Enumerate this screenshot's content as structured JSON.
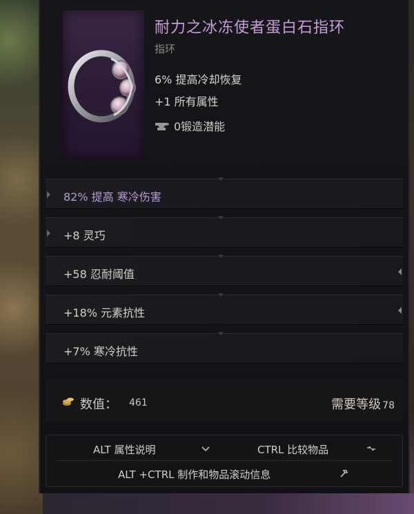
{
  "item": {
    "name": "耐力之冰冻使者蛋白石指环",
    "type": "指环",
    "implicits": [
      "6% 提高冷却恢复",
      "+1 所有属性"
    ],
    "forge_potential": "0锻造潜能"
  },
  "affixes": [
    {
      "text": "82% 提高 寒冷伤害",
      "tone": "purple",
      "arrow": "left"
    },
    {
      "text": "+8 灵巧",
      "tone": "normal",
      "arrow": "left"
    },
    {
      "text": "+58 忍耐阈值",
      "tone": "normal",
      "arrow": "right"
    },
    {
      "text": "+18% 元素抗性",
      "tone": "normal",
      "arrow": "right"
    },
    {
      "text": "+7% 寒冷抗性",
      "tone": "normal",
      "arrow": "none"
    }
  ],
  "footer": {
    "value_label": "数值：",
    "value_num": "461",
    "requirement_label": "需要等级",
    "requirement_level": "78"
  },
  "help": {
    "alt_label": "ALT 属性说明",
    "ctrl_label": "CTRL 比较物品",
    "altctrl_label": "ALT +CTRL 制作和物品滚动信息"
  },
  "colors": {
    "name": "#c79ed8",
    "purple_affix": "#b89bd6",
    "text": "#d6d1c8"
  },
  "icons": [
    "ring-icon",
    "anvil-icon",
    "gold-coins-icon",
    "chevron-down-icon",
    "compare-arrows-icon",
    "hammer-icon"
  ]
}
